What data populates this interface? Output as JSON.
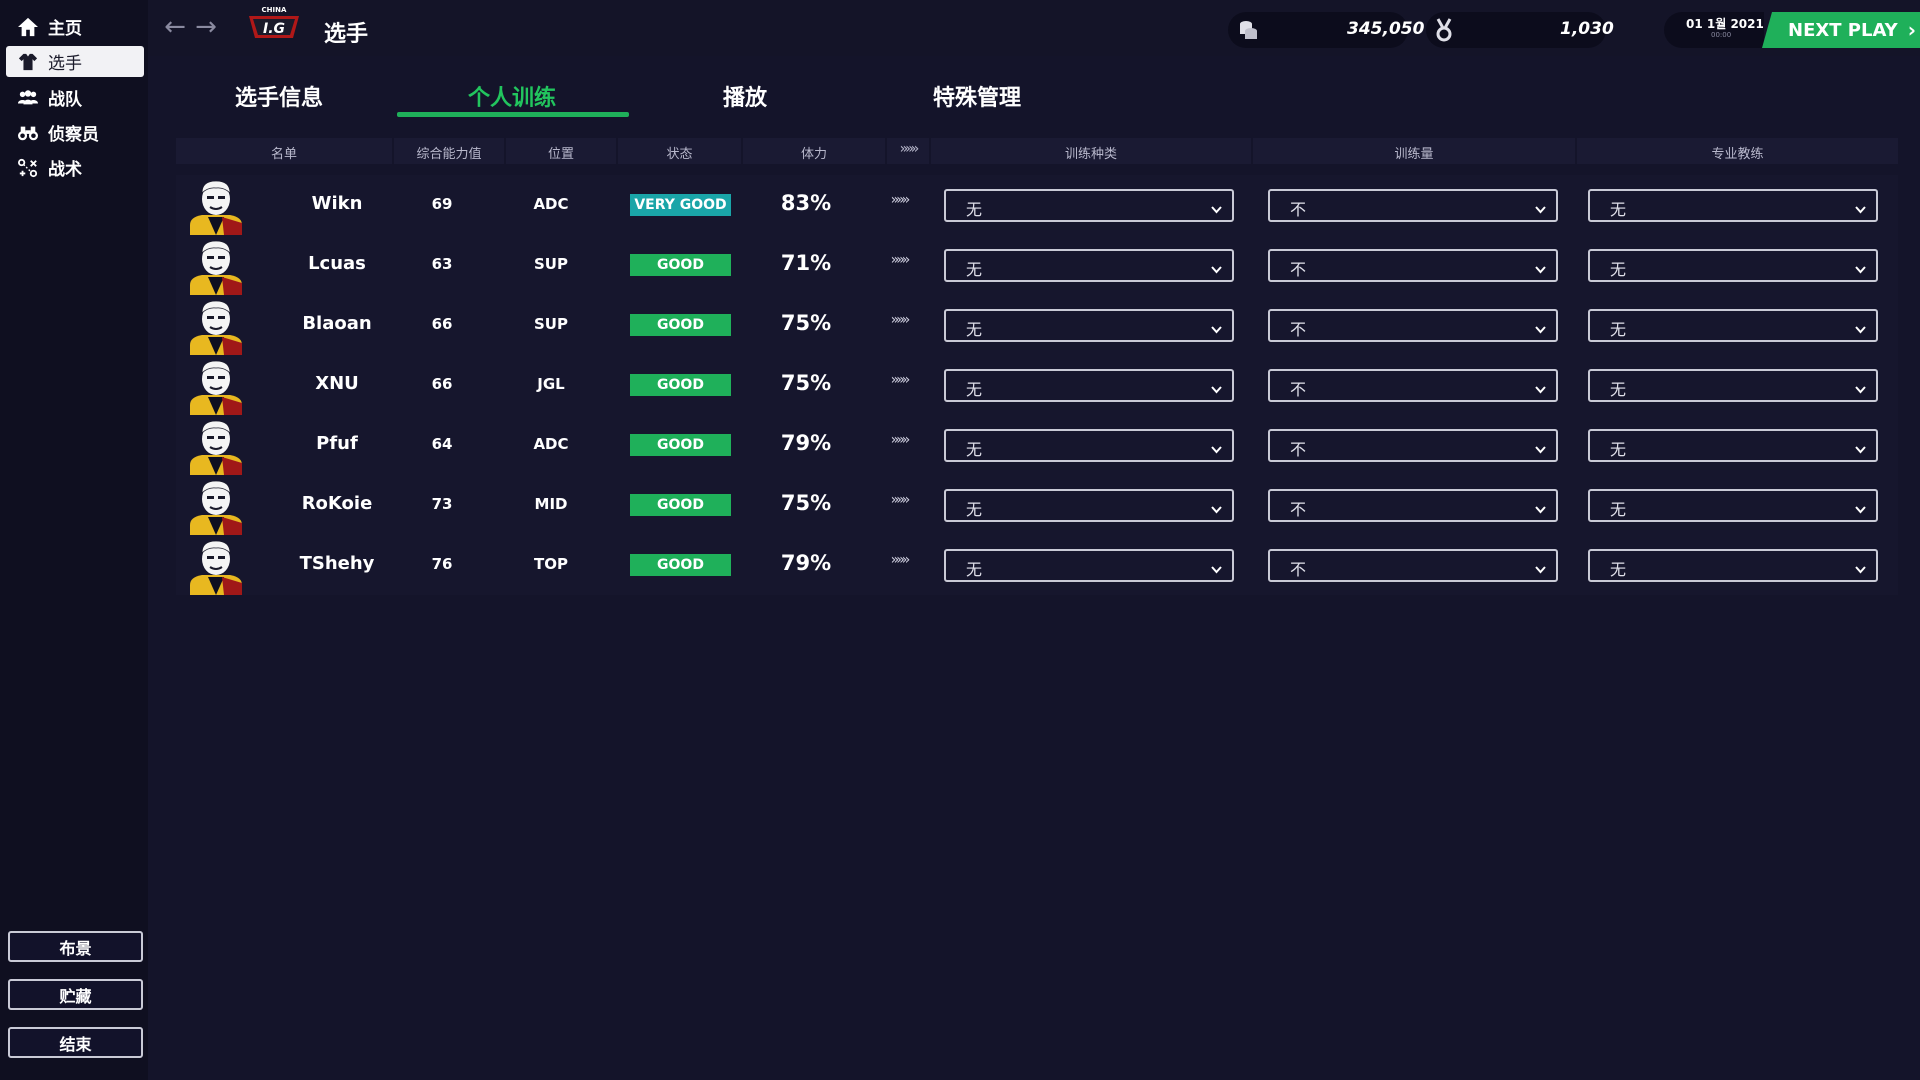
{
  "sidebar": {
    "items": [
      {
        "label": "主页",
        "icon": "home-icon"
      },
      {
        "label": "选手",
        "icon": "player-shirt-icon"
      },
      {
        "label": "战队",
        "icon": "team-icon"
      },
      {
        "label": "侦察员",
        "icon": "binoculars-icon"
      },
      {
        "label": "战术",
        "icon": "tactics-icon"
      }
    ],
    "active_index": 1,
    "bottom_buttons": [
      "布景",
      "贮藏",
      "结束"
    ]
  },
  "topbar": {
    "title": "选手",
    "logo_text": "I.G",
    "logo_sub": "CHINA",
    "money": "345,050",
    "fans": "1,030",
    "date": "01 1월 2021",
    "time": "00:00",
    "next_play": "NEXT PLAY"
  },
  "tabs": [
    {
      "label": "选手信息",
      "active": false
    },
    {
      "label": "个人训练",
      "active": true
    },
    {
      "label": "播放",
      "active": false
    },
    {
      "label": "特殊管理",
      "active": false
    }
  ],
  "table": {
    "headers": {
      "name": "名单",
      "ovr": "综合能力值",
      "pos": "位置",
      "status": "状态",
      "stamina": "体力",
      "arrows": "»»»",
      "train_type": "训练种类",
      "train_amount": "训练量",
      "coach": "专业教练"
    },
    "rows": [
      {
        "name": "Wikn",
        "ovr": "69",
        "pos": "ADC",
        "status": "VERY GOOD",
        "stamina": "83%",
        "chev": "»»»",
        "train_type": "无",
        "train_amount": "不",
        "coach": "无"
      },
      {
        "name": "Lcuas",
        "ovr": "63",
        "pos": "SUP",
        "status": "GOOD",
        "stamina": "71%",
        "chev": "»»»",
        "train_type": "无",
        "train_amount": "不",
        "coach": "无"
      },
      {
        "name": "Blaoan",
        "ovr": "66",
        "pos": "SUP",
        "status": "GOOD",
        "stamina": "75%",
        "chev": "»»»",
        "train_type": "无",
        "train_amount": "不",
        "coach": "无"
      },
      {
        "name": "XNU",
        "ovr": "66",
        "pos": "JGL",
        "status": "GOOD",
        "stamina": "75%",
        "chev": "»»»",
        "train_type": "无",
        "train_amount": "不",
        "coach": "无"
      },
      {
        "name": "Pfuf",
        "ovr": "64",
        "pos": "ADC",
        "status": "GOOD",
        "stamina": "79%",
        "chev": "»»»",
        "train_type": "无",
        "train_amount": "不",
        "coach": "无"
      },
      {
        "name": "RoKoie",
        "ovr": "73",
        "pos": "MID",
        "status": "GOOD",
        "stamina": "75%",
        "chev": "»»»",
        "train_type": "无",
        "train_amount": "不",
        "coach": "无"
      },
      {
        "name": "TShehy",
        "ovr": "76",
        "pos": "TOP",
        "status": "GOOD",
        "stamina": "79%",
        "chev": "»»»",
        "train_type": "无",
        "train_amount": "不",
        "coach": "无"
      }
    ]
  },
  "colors": {
    "accent": "#1fb05a",
    "very_good": "#1aa5a8",
    "good": "#1fb05a",
    "background": "#14142a"
  }
}
